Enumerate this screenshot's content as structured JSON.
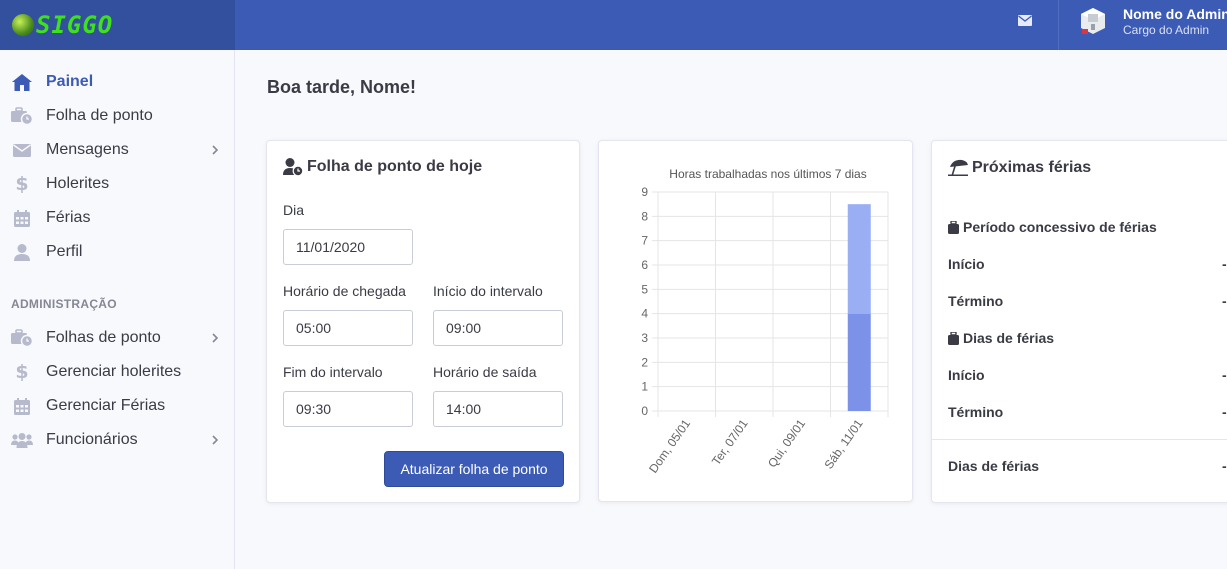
{
  "brand": {
    "text": "SIGGO",
    "color": "#3fe01c"
  },
  "topbar": {
    "user_name": "Nome do Admin",
    "user_role": "Cargo do Admin",
    "mail_icon": "envelope-icon",
    "color": "#3c5bb4"
  },
  "sidebar": {
    "items": [
      {
        "label": "Painel",
        "icon": "home-icon",
        "active": true
      },
      {
        "label": "Folha de ponto",
        "icon": "briefcase-clock-icon"
      },
      {
        "label": "Mensagens",
        "icon": "envelope-icon",
        "has_submenu": true
      },
      {
        "label": "Holerites",
        "icon": "dollar-icon"
      },
      {
        "label": "Férias",
        "icon": "calendar-icon"
      },
      {
        "label": "Perfil",
        "icon": "user-icon"
      }
    ],
    "admin_title": "ADMINISTRAÇÃO",
    "admin_items": [
      {
        "label": "Folhas de ponto",
        "icon": "briefcase-clock-icon",
        "has_submenu": true
      },
      {
        "label": "Gerenciar holerites",
        "icon": "dollar-icon"
      },
      {
        "label": "Gerenciar Férias",
        "icon": "calendar-icon"
      },
      {
        "label": "Funcionários",
        "icon": "users-icon",
        "has_submenu": true
      }
    ]
  },
  "main": {
    "greeting": "Boa tarde, Nome!",
    "timesheet": {
      "title": "Folha de ponto de hoje",
      "icon": "user-clock-icon",
      "day_label": "Dia",
      "day_value": "11/01/2020",
      "arrival_label": "Horário de chegada",
      "arrival_value": "05:00",
      "break_start_label": "Início do intervalo",
      "break_start_value": "09:00",
      "break_end_label": "Fim do intervalo",
      "break_end_value": "09:30",
      "exit_label": "Horário de saída",
      "exit_value": "14:00",
      "submit_label": "Atualizar folha de ponto"
    },
    "vacation": {
      "title": "Próximas férias",
      "icon": "umbrella-beach-icon",
      "period_title": "Período concessivo de férias",
      "period_start_label": "Início",
      "period_start_value": "-",
      "period_end_label": "Término",
      "period_end_value": "-",
      "days_title": "Dias de férias",
      "days_start_label": "Início",
      "days_start_value": "-",
      "days_end_label": "Término",
      "days_end_value": "-",
      "total_label": "Dias de férias",
      "total_value": "-"
    }
  },
  "chart_data": {
    "type": "bar",
    "title": "Horas trabalhadas nos últimos 7 dias",
    "categories": [
      "Dom, 05/01",
      "Ter, 07/01",
      "Qui, 09/01",
      "Sáb, 11/01"
    ],
    "series": [
      {
        "values": [
          0,
          0,
          0,
          4
        ],
        "color": "#7b92e8"
      },
      {
        "values": [
          0,
          0,
          0,
          4.5
        ],
        "color": "#9aaef3"
      }
    ],
    "stacked": true,
    "ylim": [
      0,
      9
    ],
    "yticks": [
      0,
      1,
      2,
      3,
      4,
      5,
      6,
      7,
      8,
      9
    ],
    "grid": true,
    "xlabel": "",
    "ylabel": ""
  }
}
